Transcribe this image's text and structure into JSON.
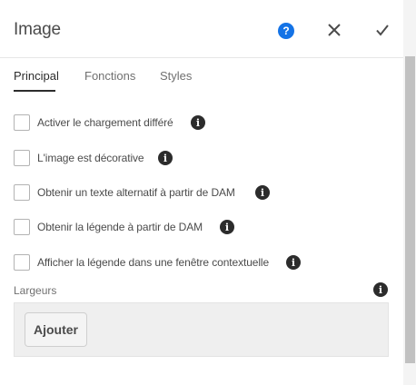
{
  "dialog": {
    "title": "Image",
    "help_icon": "help-circle-icon",
    "close_icon": "close-icon",
    "done_icon": "checkmark-icon",
    "accent_color": "#1473e6"
  },
  "tabs": [
    {
      "label": "Principal",
      "active": true
    },
    {
      "label": "Fonctions",
      "active": false
    },
    {
      "label": "Styles",
      "active": false
    }
  ],
  "options": [
    {
      "label": "Activer le chargement différé",
      "checked": false
    },
    {
      "label": "L'image est décorative",
      "checked": false
    },
    {
      "label": "Obtenir un texte alternatif à partir de DAM",
      "checked": false
    },
    {
      "label": "Obtenir la légende à partir de DAM",
      "checked": false
    },
    {
      "label": "Afficher la légende dans une fenêtre contextuelle",
      "checked": false
    }
  ],
  "widths": {
    "label": "Largeurs",
    "add_label": "Ajouter"
  },
  "info_icon_glyph": "i"
}
